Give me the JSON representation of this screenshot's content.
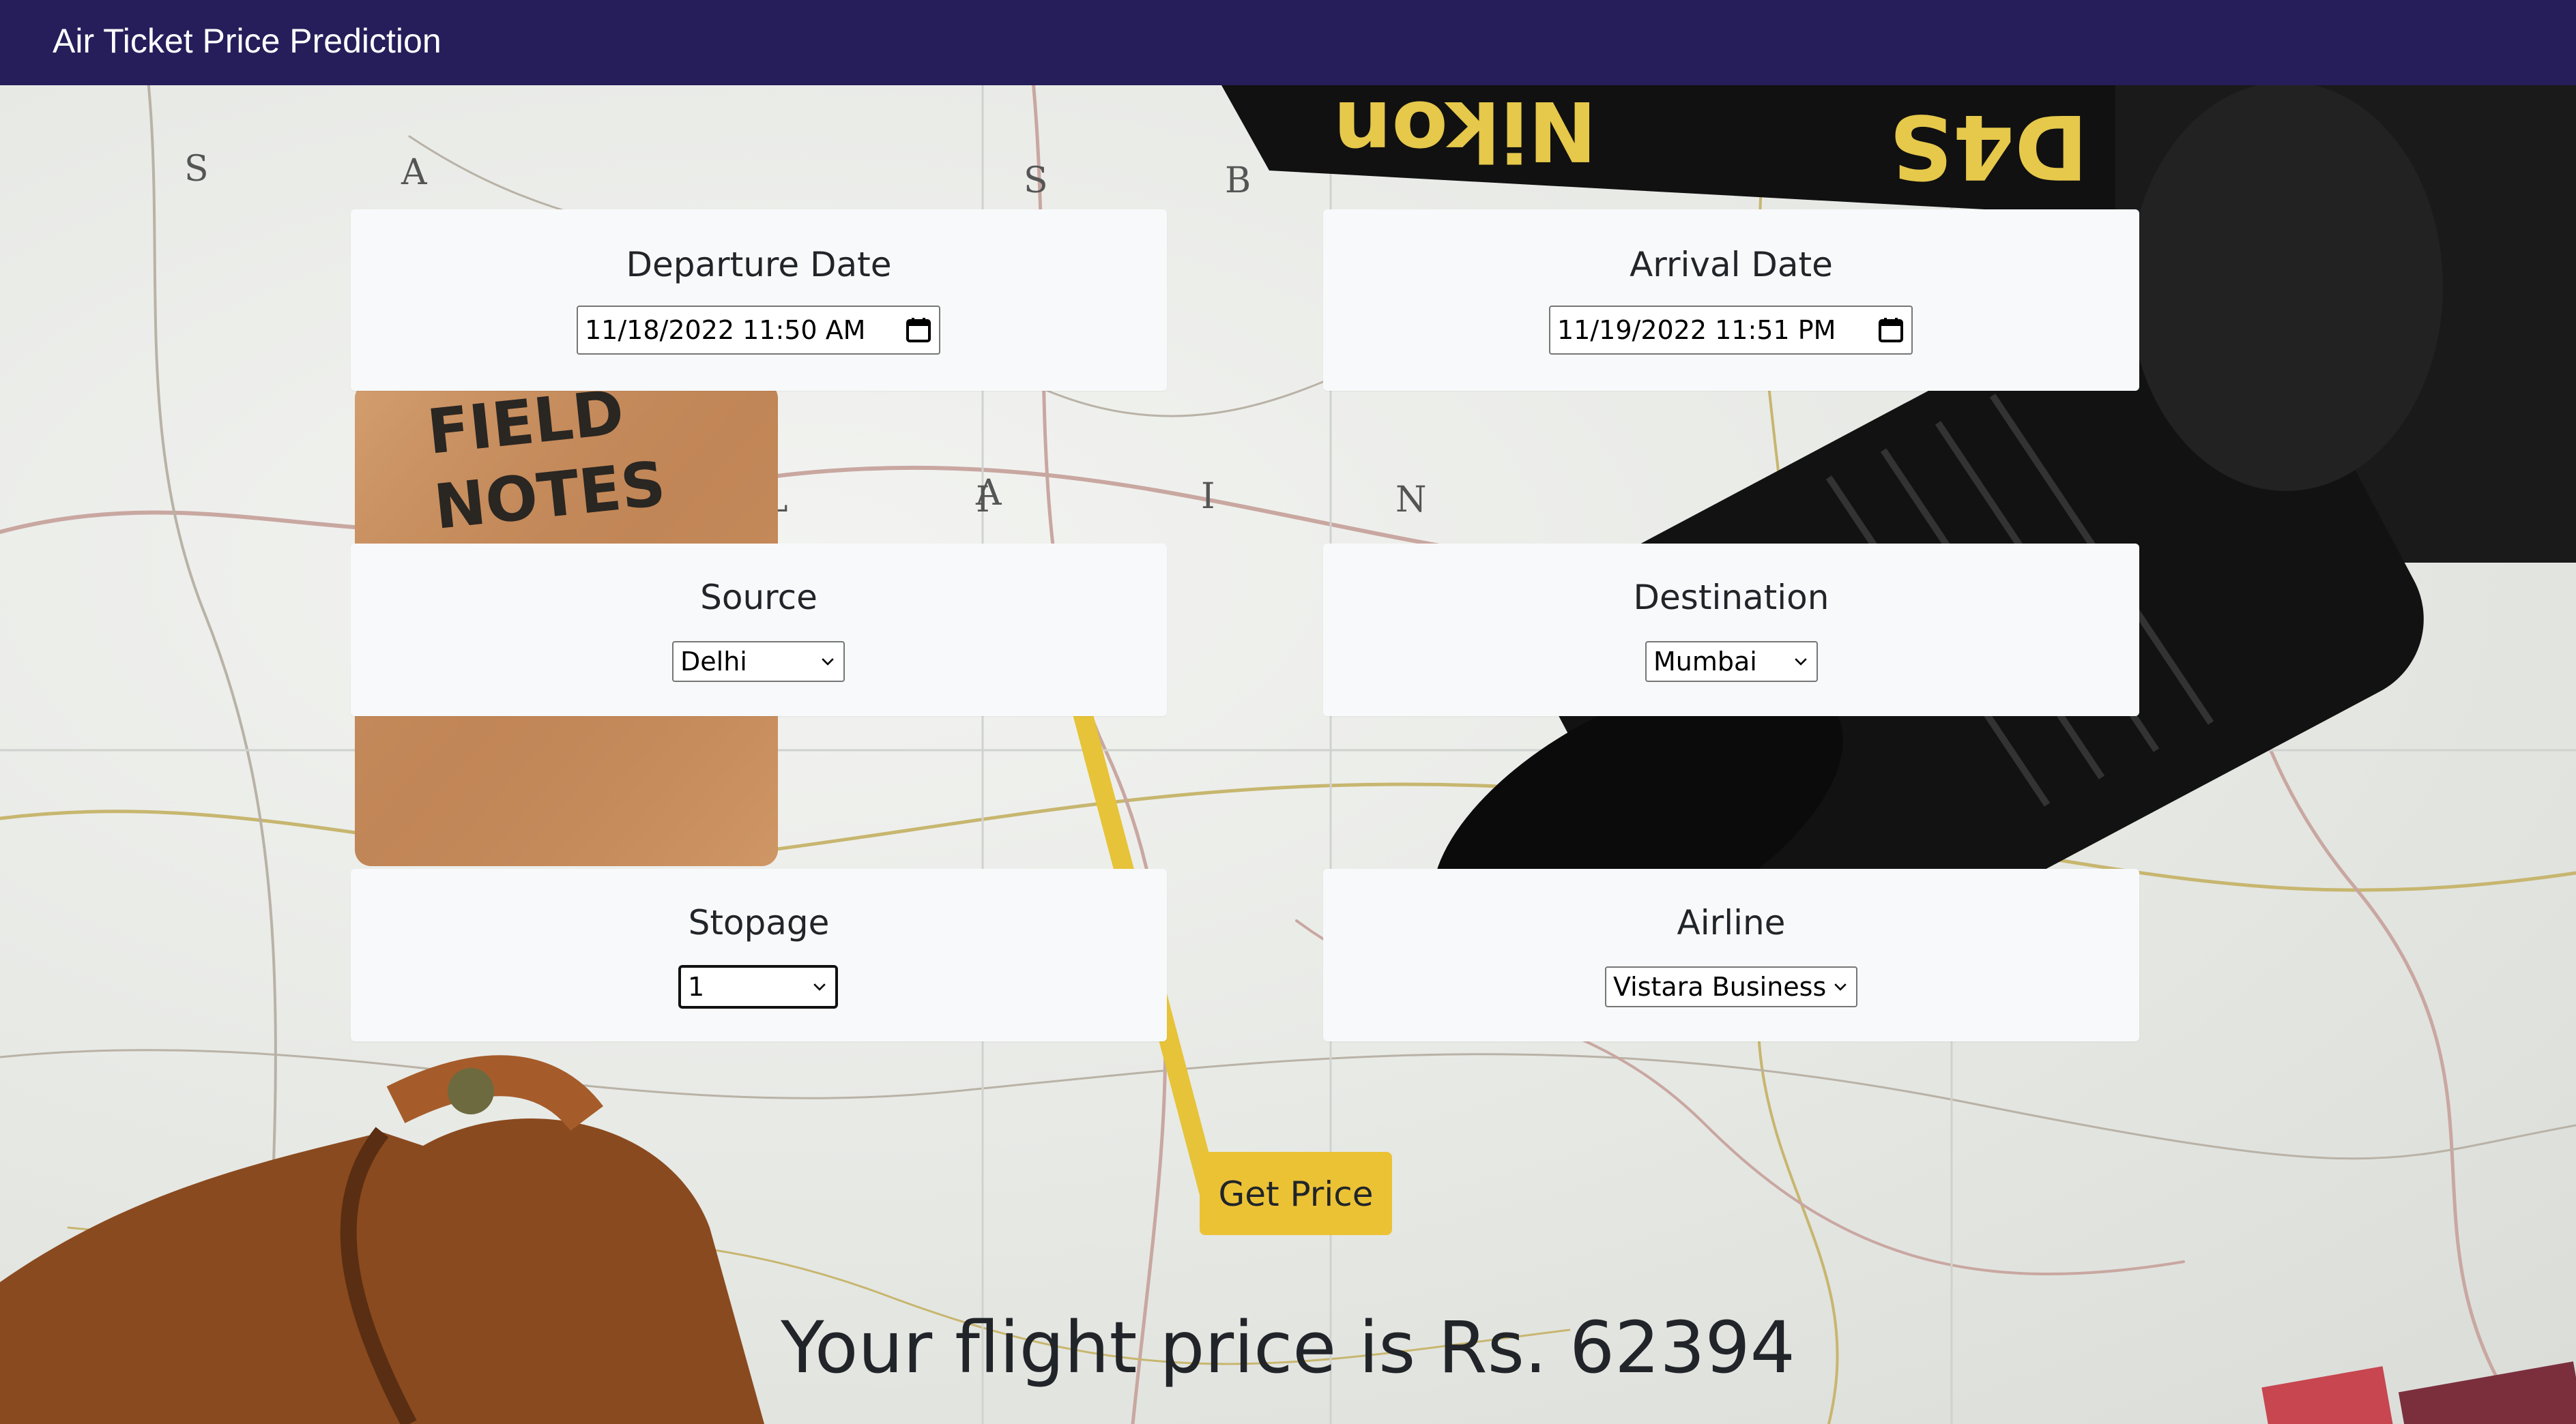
{
  "navbar": {
    "brand": "Air Ticket Price Prediction"
  },
  "form": {
    "departure": {
      "label": "Departure Date",
      "value": "11/18/2022  11:50  AM",
      "icon": "calendar-icon"
    },
    "arrival": {
      "label": "Arrival Date",
      "value": "11/19/2022  11:51  PM",
      "icon": "calendar-icon"
    },
    "source": {
      "label": "Source",
      "value": "Delhi",
      "icon": "chevron-down-icon"
    },
    "destination": {
      "label": "Destination",
      "value": "Mumbai",
      "icon": "chevron-down-icon"
    },
    "stopage": {
      "label": "Stopage",
      "value": "1",
      "icon": "chevron-down-icon"
    },
    "airline": {
      "label": "Airline",
      "value": "Vistara Business",
      "icon": "chevron-down-icon"
    },
    "submit_label": "Get Price"
  },
  "result": {
    "text": "Your flight price is Rs. 62394"
  },
  "background": {
    "camera_strap_text_1": "Nikon",
    "camera_strap_text_2": "D4S",
    "notebook_text_1": "FIELD",
    "notebook_text_2": "NOTES",
    "map_letters": [
      "S",
      "A",
      "L",
      "I",
      "S",
      "B",
      "L",
      "A",
      "I",
      "N"
    ],
    "colors": {
      "navbar": "#251e5a",
      "card": "#f8f9fa",
      "button": "#ecc235"
    }
  }
}
